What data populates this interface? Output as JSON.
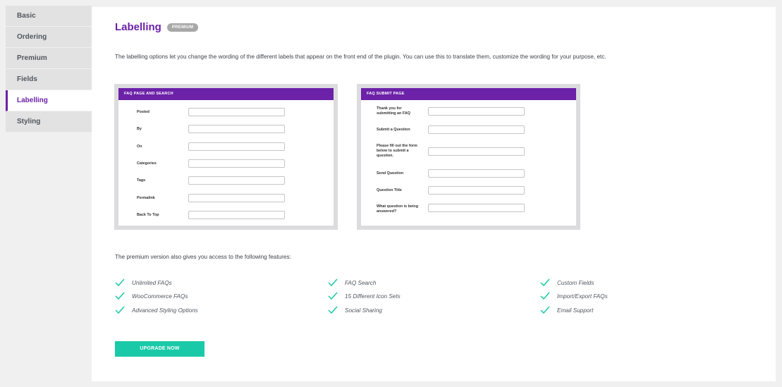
{
  "sidebar": {
    "items": [
      {
        "label": "Basic"
      },
      {
        "label": "Ordering"
      },
      {
        "label": "Premium"
      },
      {
        "label": "Fields"
      },
      {
        "label": "Labelling"
      },
      {
        "label": "Styling"
      }
    ],
    "active": "Labelling"
  },
  "main": {
    "title": "Labelling",
    "badge": "PREMIUM",
    "intro": "The labelling options let you change the wording of the different labels that appear on the front end of the plugin. You can use this to translate them, customize the wording for your purpose, etc.",
    "preview_faq": {
      "header": "FAQ PAGE AND SEARCH",
      "labels": [
        "Posted",
        "By",
        "On",
        "Categories",
        "Tags",
        "Permalink",
        "Back To Top"
      ]
    },
    "preview_submit": {
      "header": "FAQ SUBMIT PAGE",
      "labels": [
        "Thank you for submitting an FAQ",
        "Submit a Question",
        "Please fill out the form below to submit a question.",
        "Send Question",
        "Question Title",
        "What question is being answered?"
      ]
    },
    "features_intro": "The premium version also gives you access to the following features:",
    "features": [
      "Unlimited FAQs",
      "WooCommerce FAQs",
      "Advanced Styling Options",
      "FAQ Search",
      "15 Different Icon Sets",
      "Social Sharing",
      "Custom Fields",
      "Import/Export FAQs",
      "Email Support"
    ],
    "upgrade_label": "UPGRADE NOW"
  },
  "colors": {
    "accent": "#6b21a8",
    "button": "#1ac9a8",
    "check": "#1ac9a8"
  }
}
